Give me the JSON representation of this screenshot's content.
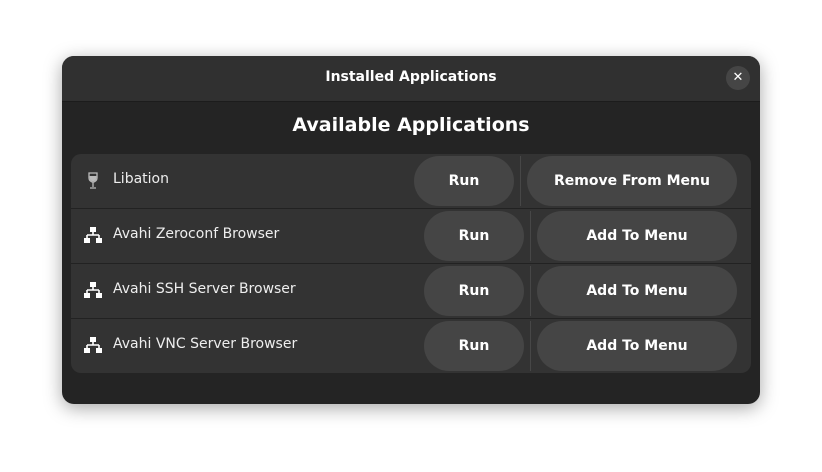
{
  "window": {
    "title": "Installed Applications",
    "close_icon": "close-icon"
  },
  "heading": "Available Applications",
  "apps": [
    {
      "name": "Libation",
      "icon": "wine-glass-icon",
      "run": "Run",
      "action": "Remove From Menu"
    },
    {
      "name": "Avahi Zeroconf Browser",
      "icon": "network-icon",
      "run": "Run",
      "action": "Add To Menu"
    },
    {
      "name": "Avahi SSH Server Browser",
      "icon": "network-icon",
      "run": "Run",
      "action": "Add To Menu"
    },
    {
      "name": "Avahi VNC Server Browser",
      "icon": "network-icon",
      "run": "Run",
      "action": "Add To Menu"
    }
  ]
}
